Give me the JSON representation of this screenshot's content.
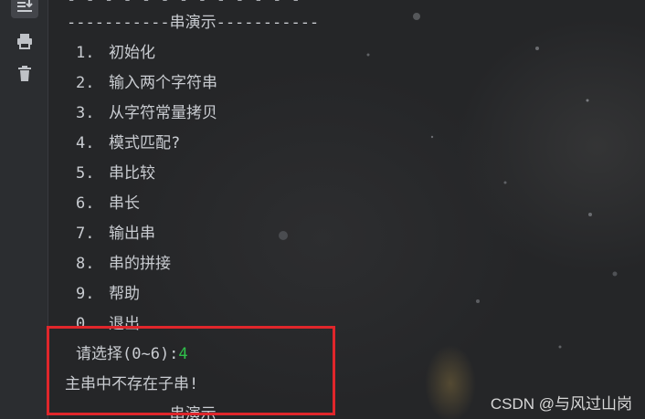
{
  "sidebar": {
    "icons": [
      "scroll-to-end-icon",
      "print-icon",
      "trash-icon"
    ]
  },
  "console": {
    "divider_text": "-----------串演示-----------",
    "menu": [
      {
        "num": "1.",
        "label": "初始化"
      },
      {
        "num": "2.",
        "label": "输入两个字符串"
      },
      {
        "num": "3.",
        "label": "从字符常量拷贝"
      },
      {
        "num": "4.",
        "label": "模式匹配?"
      },
      {
        "num": "5.",
        "label": "串比较"
      },
      {
        "num": "6.",
        "label": "串长"
      },
      {
        "num": "7.",
        "label": "输出串"
      },
      {
        "num": "8.",
        "label": "串的拼接"
      },
      {
        "num": "9.",
        "label": "帮助"
      },
      {
        "num": "0.",
        "label": "退出"
      }
    ],
    "prompt_text": "请选择(0~6):",
    "input_value": "4",
    "message": "主串中不存在子串!"
  },
  "watermark": "CSDN @与风过山岗",
  "colors": {
    "highlight_border": "#e0262b",
    "input_value": "#2fbf4a",
    "text": "#c9ccd1"
  }
}
